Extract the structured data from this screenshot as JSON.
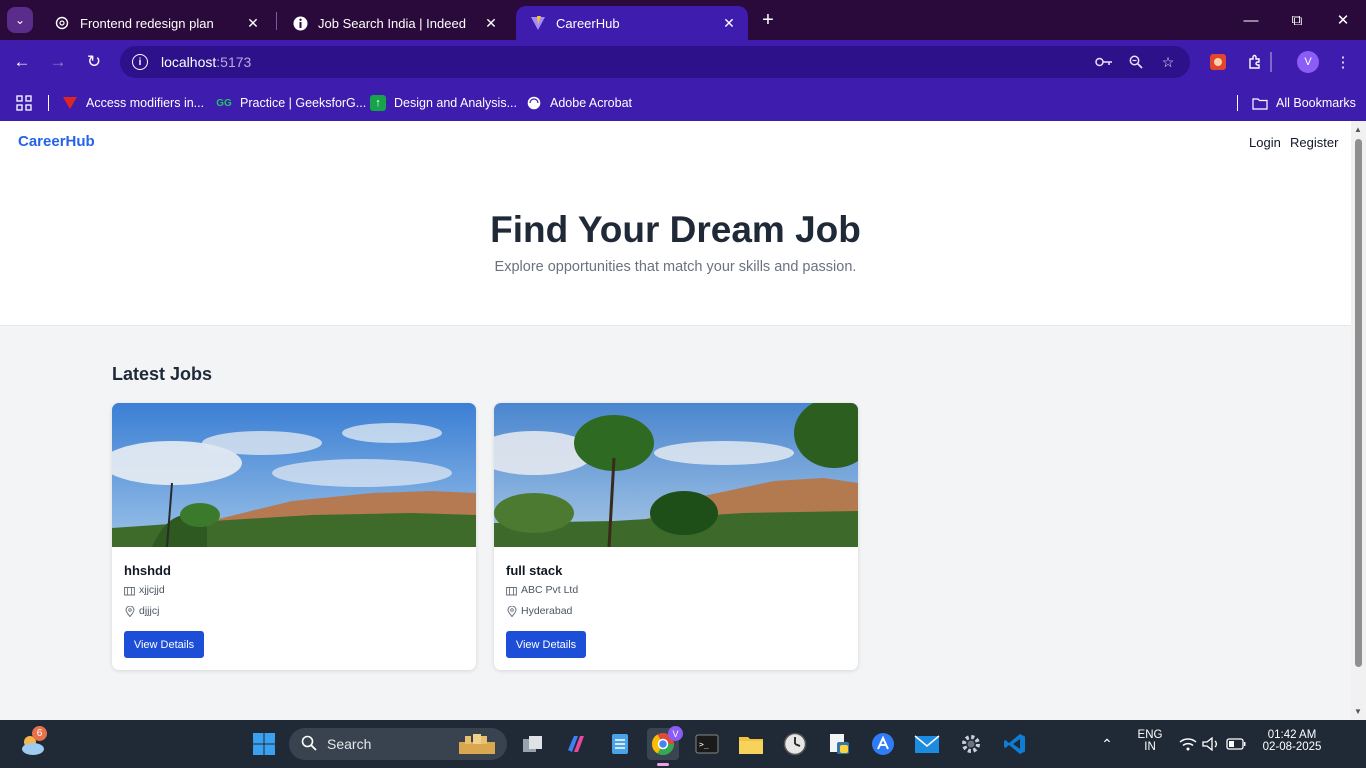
{
  "browser": {
    "tabs": [
      {
        "title": "Frontend redesign plan",
        "icon": "openai-icon",
        "active": false
      },
      {
        "title": "Job Search India | Indeed",
        "icon": "indeed-icon",
        "active": false
      },
      {
        "title": "CareerHub",
        "icon": "vite-icon",
        "active": true
      }
    ],
    "url_host": "localhost",
    "url_port": ":5173",
    "profile_initial": "V",
    "bookmarks": [
      {
        "label": "Access modifiers in...",
        "icon": "bookmark-v-icon"
      },
      {
        "label": "Practice | GeeksforG...",
        "icon": "geeksforgeeks-icon"
      },
      {
        "label": "Design and Analysis...",
        "icon": "bookmark-green-icon"
      },
      {
        "label": "Adobe Acrobat",
        "icon": "globe-icon"
      }
    ],
    "all_bookmarks": "All Bookmarks"
  },
  "app": {
    "brand": "CareerHub",
    "nav": {
      "login": "Login",
      "register": "Register"
    },
    "hero": {
      "title": "Find Your Dream Job",
      "subtitle": "Explore opportunities that match your skills and passion."
    },
    "section_title": "Latest Jobs",
    "jobs": [
      {
        "title": "hhshdd",
        "company": "xjjcjjd",
        "location": "djjjcj",
        "button": "View Details"
      },
      {
        "title": "full stack",
        "company": "ABC Pvt Ltd",
        "location": "Hyderabad",
        "button": "View Details"
      }
    ]
  },
  "taskbar": {
    "weather_badge": "6",
    "search_placeholder": "Search",
    "lang_top": "ENG",
    "lang_bottom": "IN",
    "time": "01:42 AM",
    "date": "02-08-2025",
    "chrome_profile_badge": "V"
  },
  "colors": {
    "brand_blue": "#2563eb",
    "button_blue": "#1d4ed8",
    "chrome_purple": "#3d1cae",
    "tabbar_dark": "#2a0a3a"
  }
}
